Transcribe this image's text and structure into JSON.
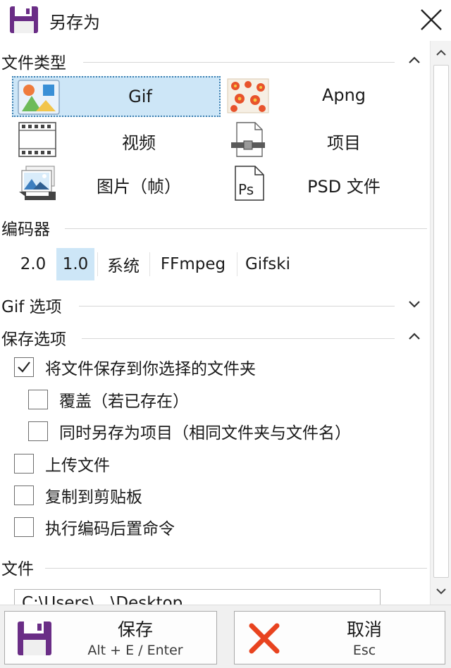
{
  "window": {
    "title": "另存为"
  },
  "sections": {
    "file_type": "文件类型",
    "encoder": "编码器",
    "gif_options": "Gif 选项",
    "save_options": "保存选项",
    "file": "文件"
  },
  "file_types": [
    {
      "label": "Gif",
      "icon": "gif-image-icon",
      "selected": true
    },
    {
      "label": "Apng",
      "icon": "apng-flowers-icon",
      "selected": false
    },
    {
      "label": "视频",
      "icon": "film-strip-icon",
      "selected": false
    },
    {
      "label": "项目",
      "icon": "project-file-icon",
      "selected": false
    },
    {
      "label": "图片（帧）",
      "icon": "images-frames-icon",
      "selected": false
    },
    {
      "label": "PSD 文件",
      "icon": "psd-file-icon",
      "selected": false
    }
  ],
  "encoders": [
    {
      "label": "2.0",
      "selected": false
    },
    {
      "label": "1.0",
      "selected": true
    },
    {
      "label": "系统",
      "selected": false
    },
    {
      "label": "FFmpeg",
      "selected": false
    },
    {
      "label": "Gifski",
      "selected": false
    }
  ],
  "save_options": [
    {
      "label": "将文件保存到你选择的文件夹",
      "checked": true
    },
    {
      "label": "覆盖（若已存在）",
      "checked": false
    },
    {
      "label": "同时另存为项目（相同文件夹与文件名）",
      "checked": false
    },
    {
      "label": "上传文件",
      "checked": false
    },
    {
      "label": "复制到剪贴板",
      "checked": false
    },
    {
      "label": "执行编码后置命令",
      "checked": false
    }
  ],
  "file": {
    "path_value": "C:\\Users\\...\\Desktop"
  },
  "buttons": {
    "save": {
      "label": "保存",
      "shortcut": "Alt + E / Enter"
    },
    "cancel": {
      "label": "取消",
      "shortcut": "Esc"
    }
  },
  "colors": {
    "accent_purple": "#6a2d86",
    "selection_blue": "#cde6f7",
    "cancel_red": "#e8431f"
  }
}
